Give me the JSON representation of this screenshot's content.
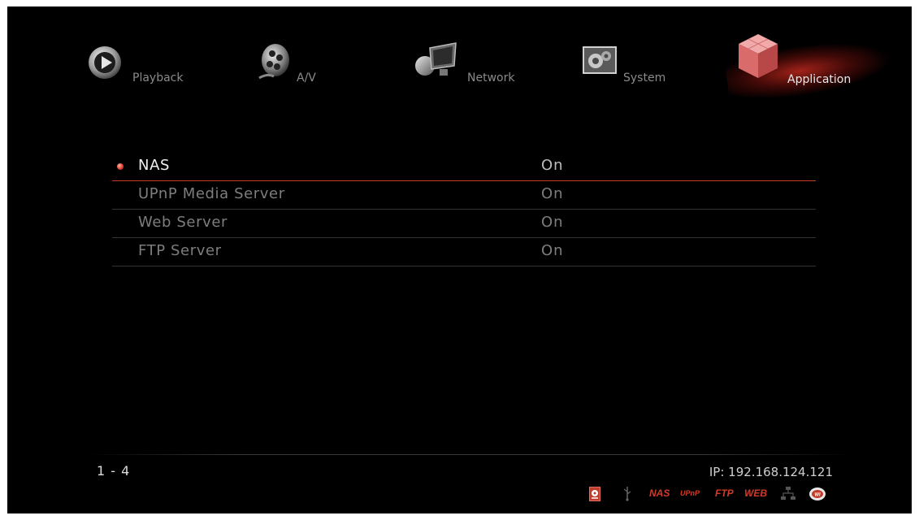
{
  "tabs": [
    {
      "label": "Playback",
      "icon": "play-icon"
    },
    {
      "label": "A/V",
      "icon": "film-reel-icon"
    },
    {
      "label": "Network",
      "icon": "network-monitor-icon"
    },
    {
      "label": "System",
      "icon": "gears-icon"
    },
    {
      "label": "Application",
      "icon": "cube-icon",
      "active": true
    }
  ],
  "list": {
    "items": [
      {
        "name": "NAS",
        "value": "On",
        "selected": true
      },
      {
        "name": "UPnP Media Server",
        "value": "On"
      },
      {
        "name": "Web Server",
        "value": "On"
      },
      {
        "name": "FTP Server",
        "value": "On"
      }
    ]
  },
  "footer": {
    "page_indicator": "1 - 4",
    "ip": "IP: 192.168.124.121",
    "status_icons": {
      "nas": "NAS",
      "upnp": "UPnP",
      "ftp": "FTP",
      "web": "WEB"
    }
  },
  "colors": {
    "accent": "#c23a2a",
    "background": "#000000"
  }
}
